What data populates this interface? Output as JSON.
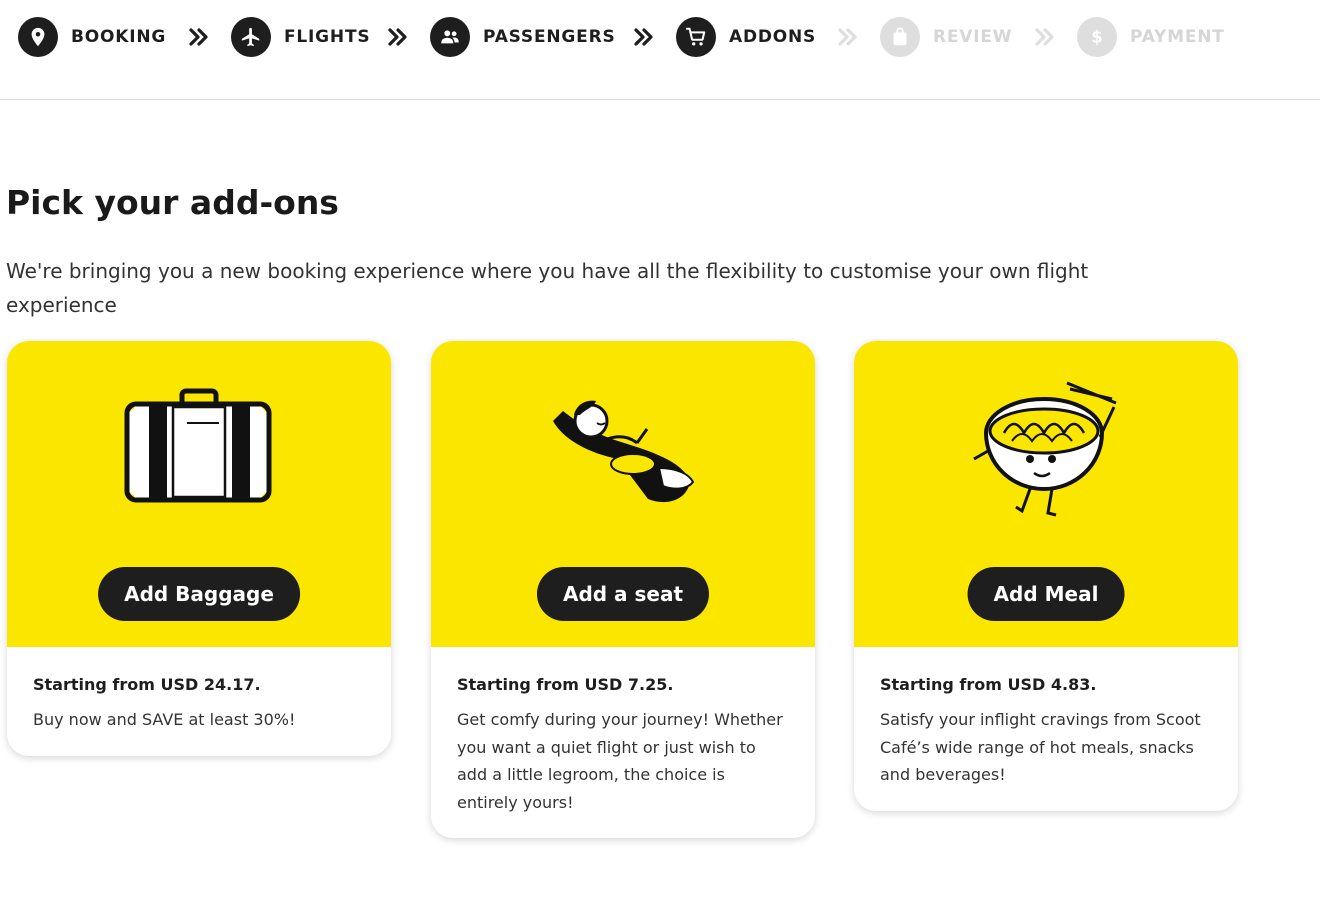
{
  "stepper": {
    "steps": [
      {
        "label": "BOOKING",
        "icon": "location-pin-icon",
        "state": "done"
      },
      {
        "label": "FLIGHTS",
        "icon": "airplane-icon",
        "state": "done"
      },
      {
        "label": "PASSENGERS",
        "icon": "people-icon",
        "state": "done"
      },
      {
        "label": "ADDONS",
        "icon": "cart-icon",
        "state": "current"
      },
      {
        "label": "REVIEW",
        "icon": "bag-icon",
        "state": "disabled"
      },
      {
        "label": "PAYMENT",
        "icon": "dollar-icon",
        "state": "disabled"
      }
    ]
  },
  "page": {
    "title": "Pick your add-ons",
    "subtitle": "We're bringing you a new booking experience where you have all the flexibility to customise your own flight experience"
  },
  "cards": [
    {
      "illustration": "suitcase-illustration",
      "cta": "Add Baggage",
      "price": "Starting from USD 24.17.",
      "description": "Buy now and SAVE at least 30%!"
    },
    {
      "illustration": "reclining-passenger-illustration",
      "cta": "Add a seat",
      "price": "Starting from USD 7.25.",
      "description": "Get comfy during your journey! Whether you want a quiet flight or just wish to add a little legroom, the choice is entirely yours!"
    },
    {
      "illustration": "noodle-bowl-illustration",
      "cta": "Add Meal",
      "price": "Starting from USD 4.83.",
      "description": "Satisfy your inflight cravings from Scoot Café’s wide range of hot meals, snacks and beverages!"
    }
  ],
  "colors": {
    "brand_yellow": "#fbe600",
    "dark": "#1e1e1e",
    "disabled": "#dedede"
  }
}
